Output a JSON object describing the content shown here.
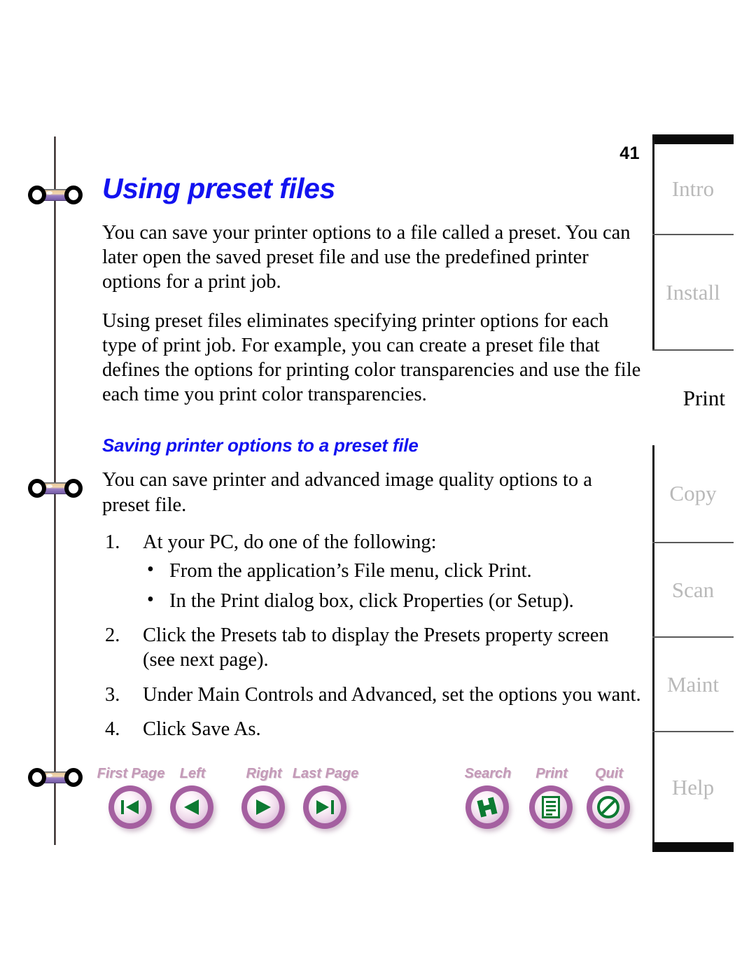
{
  "page": {
    "number": "41",
    "title": "Using preset files",
    "subtitle": "Saving printer options to a preset file",
    "paragraphs": [
      "You can save your printer options to a file called a preset. You can later open the saved preset file and use the predefined printer options for a print job.",
      "Using preset files eliminates specifying printer options for each type of print job. For example, you can create a preset file that defines the options for printing color transparencies and use the file each time you print color transparencies.",
      "You can save printer and advanced image quality options to a preset file."
    ],
    "steps": [
      {
        "num": "1.",
        "text": "At your PC, do one of the following:",
        "bullets": [
          "From the application’s File menu, click Print.",
          "In the Print dialog box, click Properties (or Setup)."
        ]
      },
      {
        "num": "2.",
        "text": "Click the Presets tab to display the Presets property screen (see next page).",
        "bullets": []
      },
      {
        "num": "3.",
        "text": "Under Main Controls and Advanced, set the options you want.",
        "bullets": []
      },
      {
        "num": "4.",
        "text": "Click Save As.",
        "bullets": []
      }
    ],
    "bullet_char": "•"
  },
  "navbar": {
    "buttons": [
      {
        "label": "First Page",
        "icon": "first-page-icon"
      },
      {
        "label": "Left",
        "icon": "previous-page-icon"
      },
      {
        "label": "Right",
        "icon": "next-page-icon"
      },
      {
        "label": "Last Page",
        "icon": "last-page-icon"
      },
      {
        "label": "Search",
        "icon": "search-icon"
      },
      {
        "label": "Print",
        "icon": "print-icon"
      },
      {
        "label": "Quit",
        "icon": "quit-icon"
      }
    ]
  },
  "tabs": [
    {
      "label": "Intro",
      "active": false
    },
    {
      "label": "Install",
      "active": false
    },
    {
      "label": "Print",
      "active": true
    },
    {
      "label": "Copy",
      "active": false
    },
    {
      "label": "Scan",
      "active": false
    },
    {
      "label": "Maint",
      "active": false
    },
    {
      "label": "Help",
      "active": false
    }
  ],
  "colors": {
    "heading_blue": "#1212f0",
    "tab_inactive": "#b9b9b9",
    "tab_active": "#000000",
    "nav_label": "#c49ab8",
    "nav_glyph_green": "#0d7a32",
    "binder_purple": "#7d63ad"
  }
}
